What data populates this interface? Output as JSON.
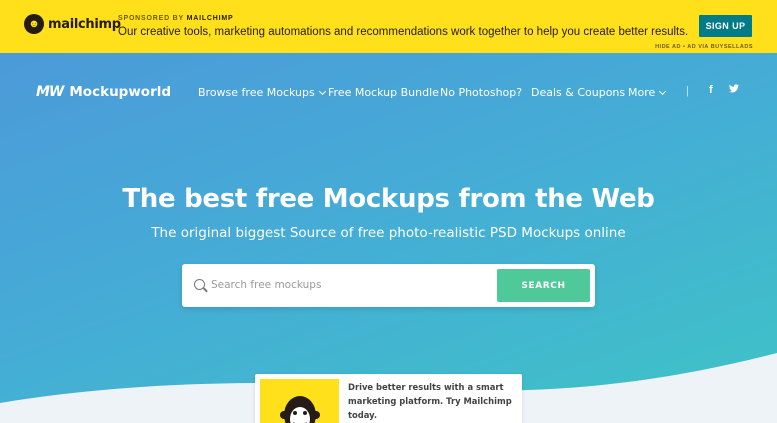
{
  "ad": {
    "logo_text": "mailchimp",
    "sponsored_prefix": "SPONSORED BY",
    "sponsored_brand": "MAILCHIMP",
    "copy": "Our creative tools, marketing automations and recommendations work together to help you create better results.",
    "cta": "SIGN UP",
    "hide_text": "HIDE AD • AD VIA BUYSELLADS",
    "bg_color": "#ffe01b",
    "cta_color": "#007c89"
  },
  "nav": {
    "brand_mark": "MW",
    "brand_name": "Mockupworld",
    "items": [
      {
        "label": "Browse free Mockups",
        "dropdown": true
      },
      {
        "label": "Free Mockup Bundle",
        "dropdown": false
      },
      {
        "label": "No Photoshop?",
        "dropdown": false
      },
      {
        "label": "Deals & Coupons",
        "dropdown": false
      },
      {
        "label": "More",
        "dropdown": true
      }
    ],
    "separator": "|",
    "social": [
      {
        "icon": "facebook-icon",
        "glyph": "f"
      },
      {
        "icon": "twitter-icon",
        "glyph": "t"
      }
    ]
  },
  "hero": {
    "title": "The best free Mockups from the Web",
    "subtitle": "The original biggest Source of free photo-realistic PSD Mockups online",
    "search_placeholder": "Search free mockups",
    "search_button": "SEARCH",
    "search_button_color": "#4fc99a"
  },
  "promo": {
    "text": "Drive better results with a smart marketing platform. Try Mailchimp today."
  }
}
